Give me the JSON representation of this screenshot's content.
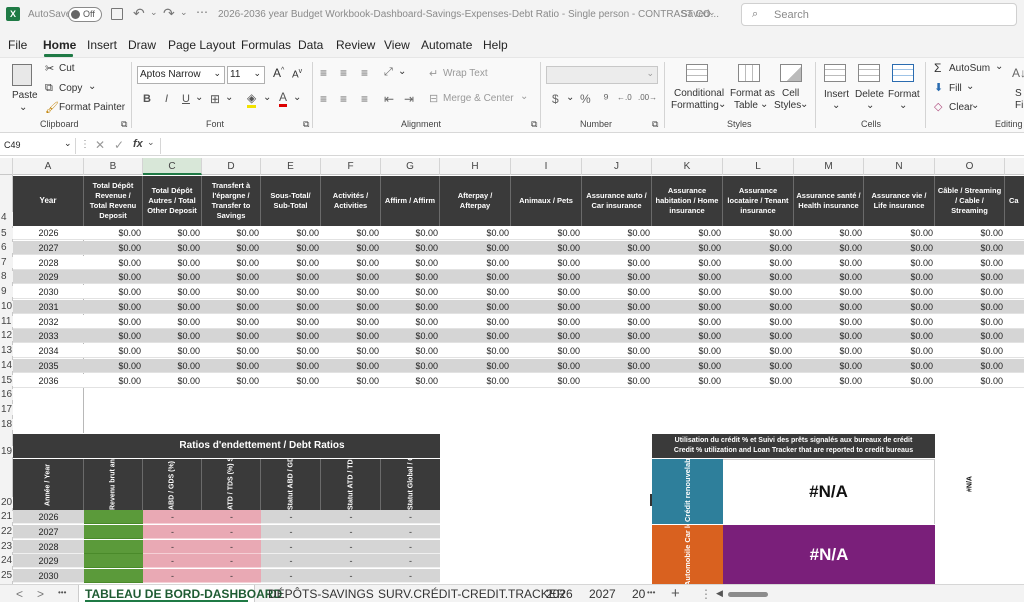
{
  "titlebar": {
    "autosave_label": "AutoSave",
    "autosave_state": "Off",
    "file_title": "2026-2036 year Budget Workbook-Dashboard-Savings-Expenses-Debt Ratio - Single person - CONTRAST CO...",
    "saved_label": "Saved",
    "search_placeholder": "Search"
  },
  "menu": [
    "File",
    "Home",
    "Insert",
    "Draw",
    "Page Layout",
    "Formulas",
    "Data",
    "Review",
    "View",
    "Automate",
    "Help"
  ],
  "ribbon": {
    "paste": "Paste",
    "cut": "Cut",
    "copy": "Copy",
    "format_painter": "Format Painter",
    "clipboard": "Clipboard",
    "font_name": "Aptos Narrow",
    "font_size": "11",
    "font": "Font",
    "wrap_text": "Wrap Text",
    "merge_center": "Merge & Center",
    "alignment": "Alignment",
    "number": "Number",
    "conditional_formatting_1": "Conditional",
    "conditional_formatting_2": "Formatting",
    "format_as_table_1": "Format as",
    "format_as_table_2": "Table",
    "cell_styles_1": "Cell",
    "cell_styles_2": "Styles",
    "styles": "Styles",
    "insert": "Insert",
    "delete": "Delete",
    "format": "Format",
    "cells": "Cells",
    "autosum": "AutoSum",
    "fill": "Fill",
    "clear": "Clear",
    "editing": "Editing"
  },
  "formula_bar": {
    "name_box": "C49",
    "fx": "fx",
    "value": ""
  },
  "columns": [
    "A",
    "B",
    "C",
    "D",
    "E",
    "F",
    "G",
    "H",
    "I",
    "J",
    "K",
    "L",
    "M",
    "N",
    "O"
  ],
  "rows": [
    "4",
    "5",
    "6",
    "7",
    "8",
    "9",
    "10",
    "11",
    "12",
    "13",
    "14",
    "15",
    "16",
    "17",
    "18",
    "19",
    "20",
    "21",
    "22",
    "23",
    "24",
    "25"
  ],
  "top_headers": [
    "Year",
    "Total Dépôt Revenue / Total Revenu Deposit",
    "Total Dépôt Autres / Total Other Deposit",
    "Transfert à l'épargne / Transfer to Savings",
    "Sous-Total/ Sub-Total",
    "Activités / Activities",
    "Affirm / Affirm",
    "Afterpay / Afterpay",
    "Animaux / Pets",
    "Assurance auto / Car insurance",
    "Assurance habitation / Home insurance",
    "Assurance locataire / Tenant insurance",
    "Assurance santé / Health insurance",
    "Assurance vie / Life insurance",
    "Câble / Streaming / Cable / Streaming",
    "Ca"
  ],
  "years": [
    "2026",
    "2027",
    "2028",
    "2029",
    "2030",
    "2031",
    "2032",
    "2033",
    "2034",
    "2035",
    "2036"
  ],
  "zero_value": "$0.00",
  "debt_ratio": {
    "title": "Ratios d'endettement / Debt Ratios",
    "headers": [
      "Année / Year",
      "Revenu brut annuel / Annual Gross Revenue",
      "ABD / GDS (%) Cible ≤ 39%",
      "ATD / TDS (%) Std ≤ 44% Conv ≤ 40%",
      "Statut ABD / GDS Status",
      "Statut ATD / TDS Status",
      "Statut Global / Overall Status"
    ],
    "years": [
      "2026",
      "2027",
      "2028",
      "2029",
      "2030"
    ],
    "dash": "-"
  },
  "credit": {
    "title_1": "Utilisation du crédit %  et Suivi des prêts signalés aux bureaux de crédit",
    "title_2": "Credit % utilization and  Loan Tracker that are reported to credit bureaus",
    "revolving_label": "Crédit renouvelable Revolving credit",
    "car_label": "Automobile Car loan Payé / Paid %",
    "na": "#N/A",
    "na_side": "#N/A",
    "colors": {
      "revolving": "#2e7f9b",
      "car": "#d9611f",
      "purple": "#7a1f7a"
    }
  },
  "sheet_tabs": [
    "TABLEAU DE BORD-DASHBOARD",
    "DÉPÔTS-SAVINGS",
    "SURV.CRÉDIT-CREDIT.TRACKER",
    "2026",
    "2027",
    "20"
  ],
  "tab_nav": {
    "prev": "<",
    "next": ">",
    "more": "•••",
    "add": "+",
    "menu": "⋮"
  },
  "colors": {
    "green": "#5b9a3a",
    "pink": "#e9a9b4",
    "zebra": "#d5d5d5",
    "header": "#3a3a3a"
  }
}
